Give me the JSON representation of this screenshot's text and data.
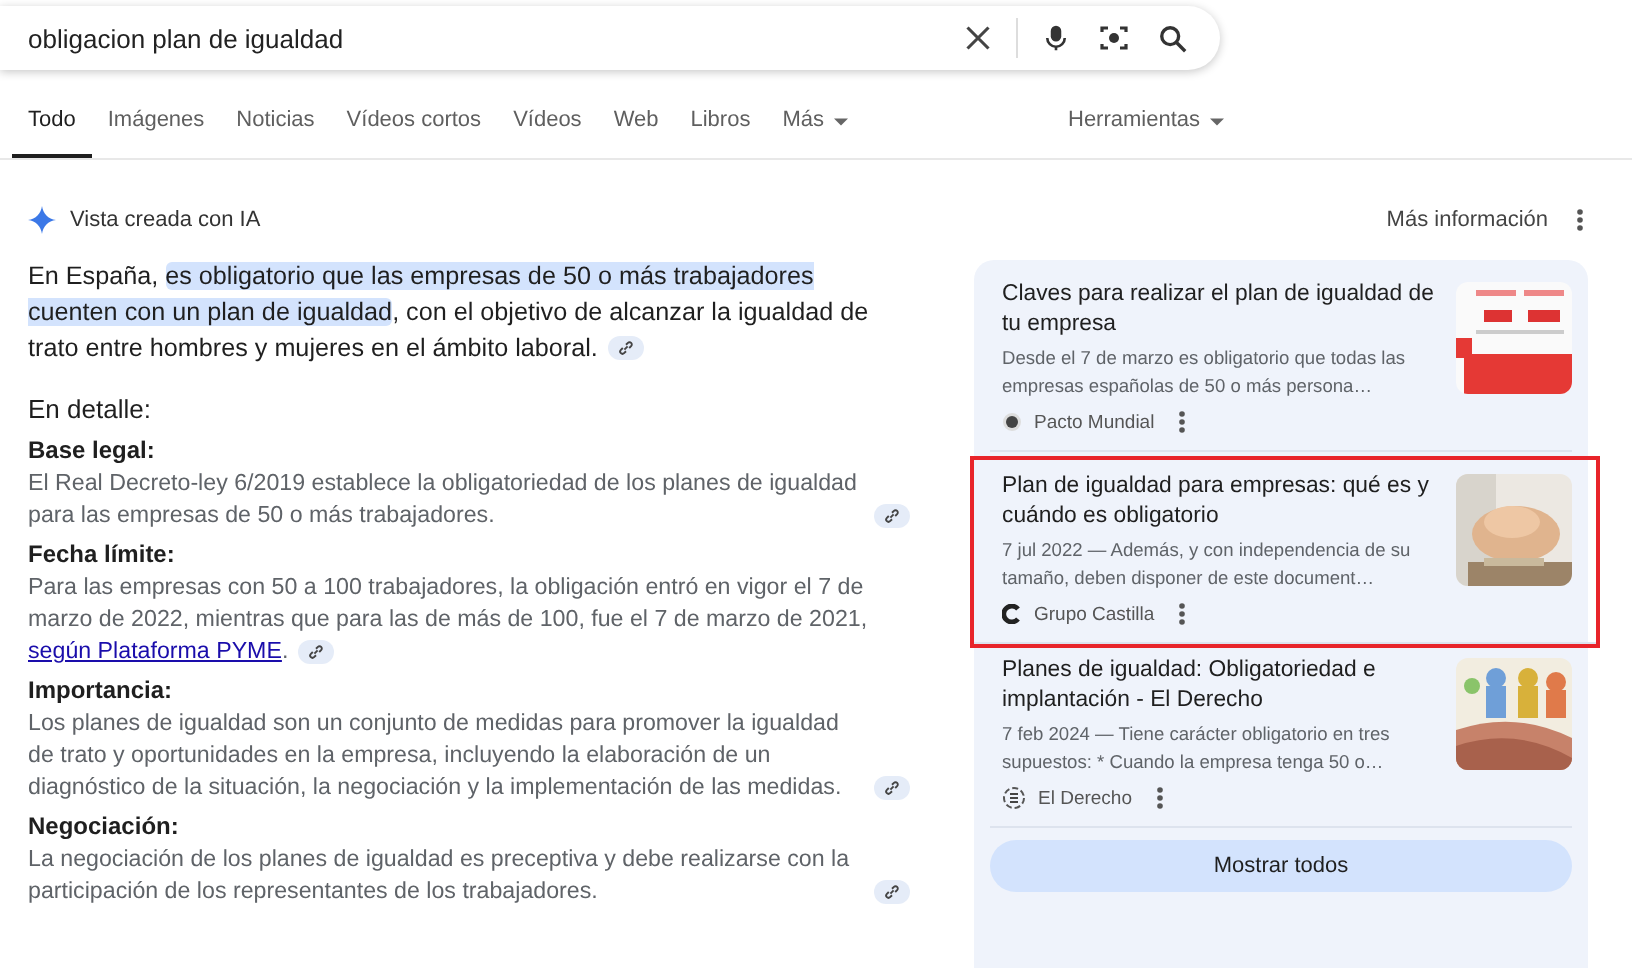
{
  "search": {
    "value": "obligacion plan de igualdad"
  },
  "tabs": [
    {
      "label": "Todo",
      "selected": true
    },
    {
      "label": "Imágenes",
      "selected": false
    },
    {
      "label": "Noticias",
      "selected": false
    },
    {
      "label": "Vídeos cortos",
      "selected": false
    },
    {
      "label": "Vídeos",
      "selected": false
    },
    {
      "label": "Web",
      "selected": false
    },
    {
      "label": "Libros",
      "selected": false
    },
    {
      "label": "Más",
      "selected": false,
      "kind": "menu"
    }
  ],
  "tools": "Herramientas",
  "ai_overview": {
    "label": "Vista creada con IA",
    "more_info": "Más información",
    "intro": {
      "before": "En España,",
      "highlight": "es obligatorio que las empresas de 50 o más trabajadores cuenten con un plan de igualdad",
      "after": ", con el objetivo de alcanzar la igualdad de trato entre hombres y mujeres en el ámbito laboral."
    },
    "detail_heading": "En detalle:",
    "details": [
      {
        "heading": "Base legal:",
        "text": "El Real Decreto-ley 6/2019 establece la obligatoriedad de los planes de igualdad para las empresas de 50 o más trabajadores."
      },
      {
        "heading": "Fecha límite:",
        "text": "Para las empresas con 50 a 100 trabajadores, la obligación entró en vigor el 7 de marzo de 2022, mientras que para las de más de 100, fue el 7 de marzo de 2021,",
        "link": "según Plataforma PYME",
        "after": "."
      },
      {
        "heading": "Importancia:",
        "text": "Los planes de igualdad son un conjunto de medidas para promover la igualdad de trato y oportunidades en la empresa, incluyendo la elaboración de un diagnóstico de la situación, la negociación y la implementación de las medidas."
      },
      {
        "heading": "Negociación:",
        "text": "La negociación de los planes de igualdad es preceptiva y debe realizarse con la participación de los representantes de los trabajadores."
      }
    ],
    "sources": [
      {
        "title": "Claves para realizar el plan de igualdad de tu empresa",
        "snippet": "Desde el 7 de marzo es obligatorio que todas las empresas españolas de 50 o más persona…",
        "site": "Pacto Mundial",
        "highlighted": false,
        "kind": "infographic"
      },
      {
        "title": "Plan de igualdad para empresas: qué es y cuándo es obligatorio",
        "snippet": "7 jul 2022 — Además, y con independencia de su tamaño, deben disponer de este document…",
        "site": "Grupo Castilla",
        "highlighted": true,
        "kind": "hands"
      },
      {
        "title": "Planes de igualdad: Obligatoriedad e implantación - El Derecho",
        "snippet": "7 feb 2024 — Tiene carácter obligatorio en tres supuestos: * Cuando la empresa tenga 50 o…",
        "site": "El Derecho",
        "highlighted": false,
        "kind": "people"
      }
    ],
    "show_all": "Mostrar todos"
  }
}
